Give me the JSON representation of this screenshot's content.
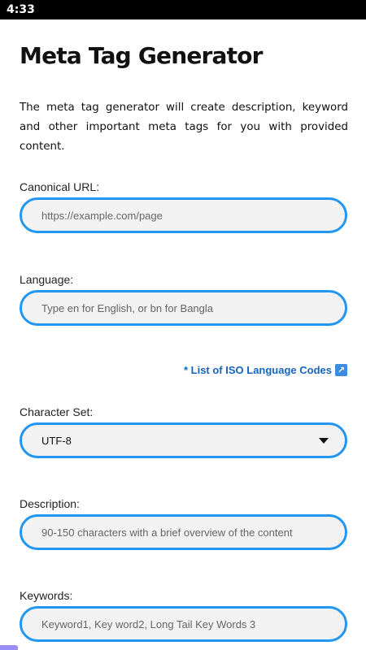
{
  "status_bar": {
    "time": "4:33"
  },
  "header": {
    "title": "Meta Tag Generator"
  },
  "intro": "The meta tag generator will create description, keyword and other important meta tags for you with provided content.",
  "form": {
    "canonical": {
      "label": "Canonical URL:",
      "placeholder": "https://example.com/page"
    },
    "language": {
      "label": "Language:",
      "placeholder": "Type en for English, or bn for Bangla"
    },
    "iso_link": {
      "text": "* List of ISO Language Codes",
      "icon": "external-link-icon"
    },
    "charset": {
      "label": "Character Set:",
      "selected": "UTF-8"
    },
    "description": {
      "label": "Description:",
      "placeholder": "90-150 characters with a brief overview of the content"
    },
    "keywords": {
      "label": "Keywords:",
      "placeholder": "Keyword1, Key word2, Long Tail Key Words 3"
    }
  },
  "colors": {
    "accent_border": "#2196f3",
    "link": "#1565c0",
    "field_bg": "#f2f2f2"
  }
}
